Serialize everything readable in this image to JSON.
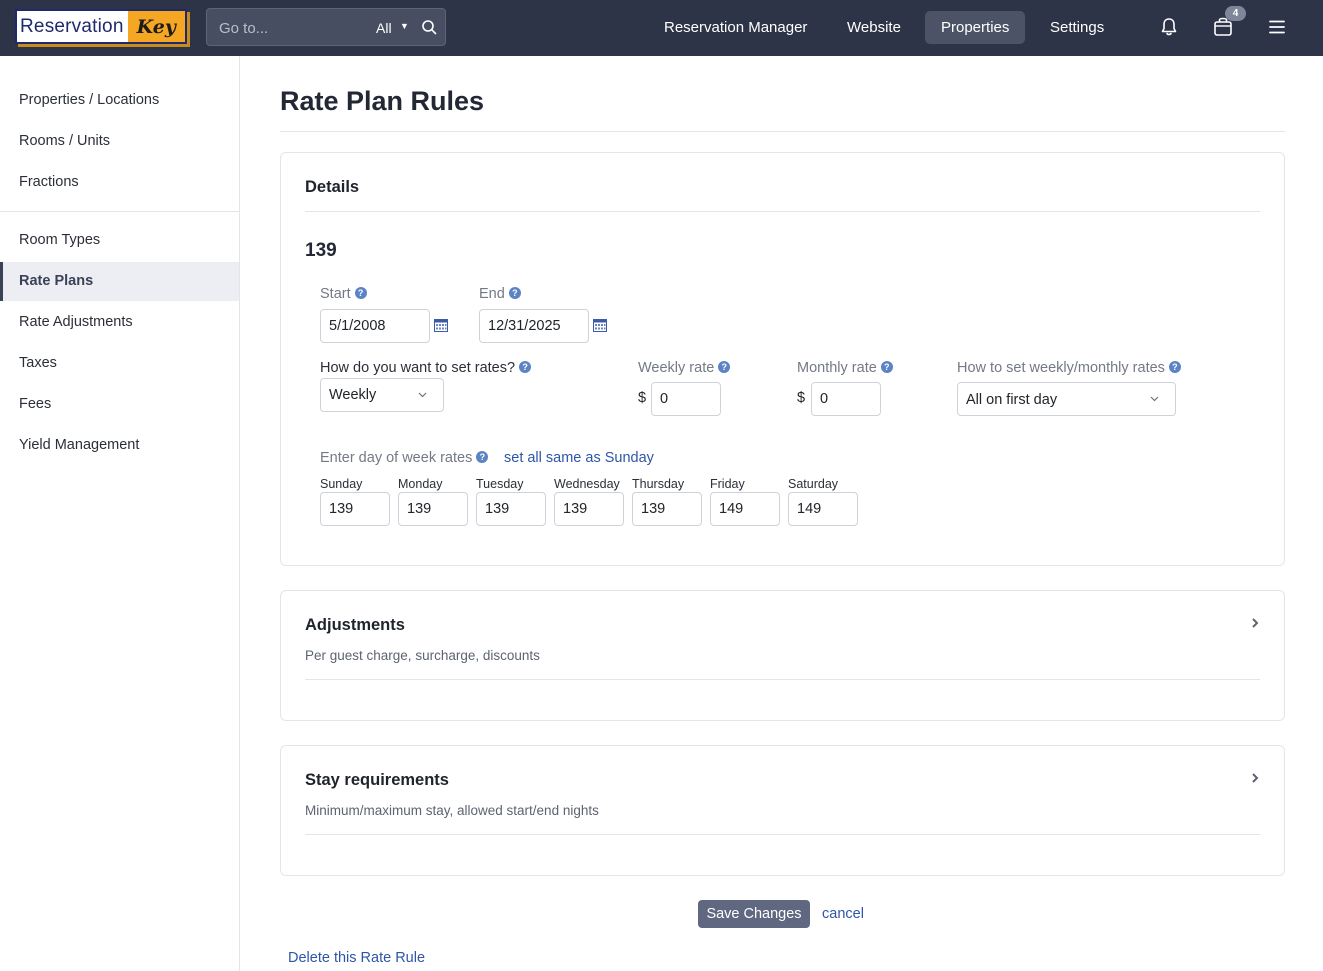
{
  "app": {
    "logo_left": "Reservation",
    "logo_right": "Key"
  },
  "search": {
    "placeholder": "Go to...",
    "scope": "All"
  },
  "nav": {
    "items": [
      "Reservation Manager",
      "Website",
      "Properties",
      "Settings"
    ],
    "active": "Properties",
    "cart_badge": "4"
  },
  "sidebar": {
    "group1": [
      "Properties / Locations",
      "Rooms / Units",
      "Fractions"
    ],
    "group2": [
      "Room Types",
      "Rate Plans",
      "Rate Adjustments",
      "Taxes",
      "Fees",
      "Yield Management"
    ],
    "active": "Rate Plans"
  },
  "page": {
    "title": "Rate Plan Rules"
  },
  "details": {
    "title": "Details",
    "rule_name": "139",
    "start_label": "Start",
    "start_value": "5/1/2008",
    "end_label": "End",
    "end_value": "12/31/2025",
    "set_rates_label": "How do you want to set rates?",
    "set_rates_value": "Weekly",
    "weekly_rate_label": "Weekly rate",
    "weekly_rate_value": "0",
    "monthly_rate_label": "Monthly rate",
    "monthly_rate_value": "0",
    "currency": "$",
    "how_set_label": "How to set weekly/monthly rates",
    "how_set_value": "All on first day",
    "dow_label": "Enter day of week rates",
    "set_all_link": "set all same as Sunday",
    "days": [
      {
        "name": "Sunday",
        "value": "139"
      },
      {
        "name": "Monday",
        "value": "139"
      },
      {
        "name": "Tuesday",
        "value": "139"
      },
      {
        "name": "Wednesday",
        "value": "139"
      },
      {
        "name": "Thursday",
        "value": "139"
      },
      {
        "name": "Friday",
        "value": "149"
      },
      {
        "name": "Saturday",
        "value": "149"
      }
    ]
  },
  "adjustments": {
    "title": "Adjustments",
    "subtitle": "Per guest charge, surcharge, discounts"
  },
  "stay": {
    "title": "Stay requirements",
    "subtitle": "Minimum/maximum stay, allowed start/end nights"
  },
  "actions": {
    "save": "Save Changes",
    "cancel": "cancel",
    "delete": "Delete this Rate Rule"
  },
  "colors": {
    "topbar": "#2e3447",
    "accent_button": "#5f6781",
    "link": "#2f56a6",
    "logo_orange": "#f5a623"
  }
}
